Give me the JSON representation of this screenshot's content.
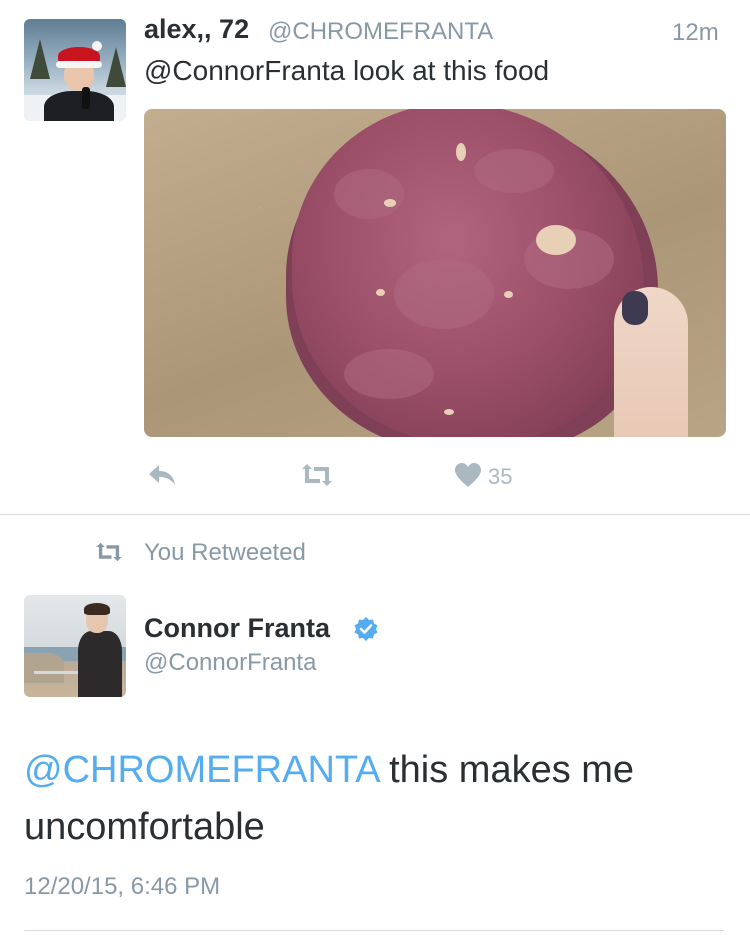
{
  "tweet1": {
    "name": "alex,, 72",
    "handle": "@CHROMEFRANTA",
    "time": "12m",
    "text": "@ConnorFranta look at this food",
    "like_count": "35"
  },
  "retweet_notice": "You Retweeted",
  "tweet2": {
    "name": "Connor Franta",
    "handle": "@ConnorFranta",
    "mention": "@CHROMEFRANTA",
    "text_rest": " this makes me uncomfortable",
    "timestamp": "12/20/15, 6:46 PM"
  },
  "colors": {
    "link": "#55acee",
    "text": "#292f33",
    "secondary": "#8899a6",
    "icon": "#aab8c2",
    "verified": "#55acee"
  },
  "icons": [
    "reply-icon",
    "retweet-icon",
    "heart-icon",
    "verified-badge-icon"
  ]
}
